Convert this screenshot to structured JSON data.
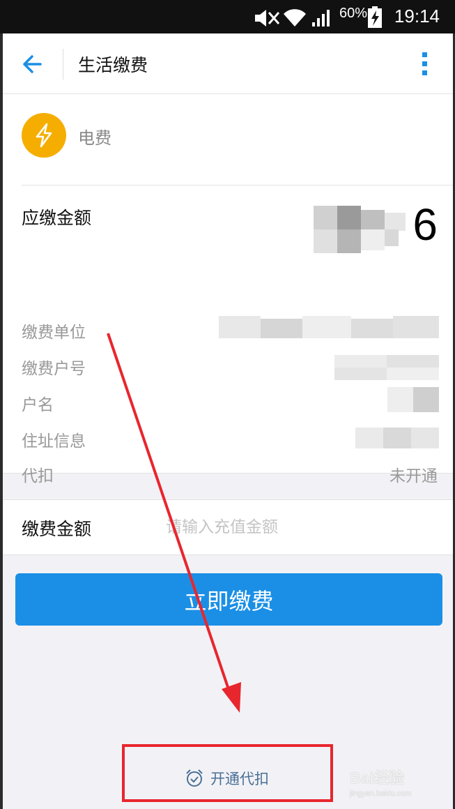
{
  "status_bar": {
    "battery_percent": "60%",
    "time": "19:14"
  },
  "app_bar": {
    "title": "生活缴费"
  },
  "bill": {
    "type_name": "电费",
    "icon_color": "#f5ae00",
    "due_label": "应缴金额",
    "due_amount_visible_suffix": "6",
    "info_rows": [
      {
        "label": "缴费单位",
        "value": ""
      },
      {
        "label": "缴费户号",
        "value": ""
      },
      {
        "label": "户名",
        "value": ""
      },
      {
        "label": "住址信息",
        "value": ""
      },
      {
        "label": "代扣",
        "value": "未开通"
      }
    ]
  },
  "payment": {
    "amount_label": "缴费金额",
    "amount_placeholder": "请输入充值金额",
    "pay_button_label": "立即缴费",
    "button_color": "#1b8fe6"
  },
  "footer": {
    "autopay_label": "开通代扣"
  },
  "annotation": {
    "color": "#e8262e"
  },
  "watermark": {
    "main": "Bai经验",
    "sub": "jingyan.baidu.com"
  }
}
